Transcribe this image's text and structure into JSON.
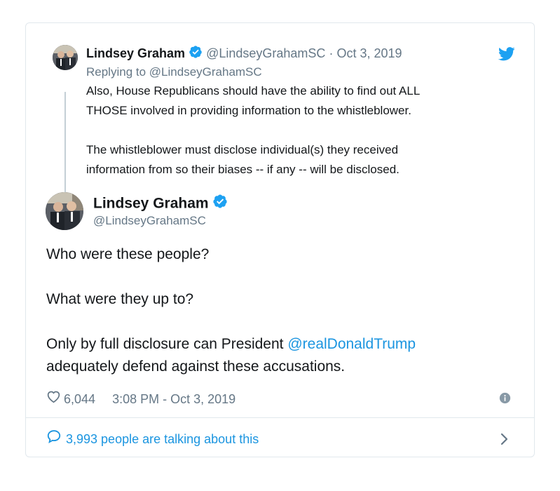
{
  "quoted": {
    "name": "Lindsey Graham",
    "handle": "@LindseyGrahamSC",
    "separator": "·",
    "date": "Oct 3, 2019",
    "replying_prefix": "Replying to",
    "replying_handle": "@LindseyGrahamSC",
    "lines": [
      "Also, House Republicans should have the ability to find out ALL",
      "THOSE involved in providing information to the whistleblower.",
      "The whistleblower must disclose individual(s) they received",
      "information from so their biases -- if any -- will be disclosed."
    ]
  },
  "main": {
    "name": "Lindsey Graham",
    "handle": "@LindseyGrahamSC",
    "p1": "Who were these people?",
    "p2": "What were they up to?",
    "p3_before": "Only by full disclosure can President ",
    "p3_mention": "@realDonaldTrump",
    "p3_after": "adequately defend against these accusations."
  },
  "meta": {
    "likes": "6,044",
    "time": "3:08 PM - Oct 3, 2019"
  },
  "footer": {
    "talking": "3,993 people are talking about this"
  },
  "colors": {
    "twitter_blue": "#1da1f2",
    "link_blue": "#1b95e0",
    "muted": "#657786"
  },
  "icons": [
    "twitter-bird-icon",
    "verified-badge-icon",
    "heart-icon",
    "info-icon",
    "comment-icon",
    "chevron-right-icon"
  ]
}
